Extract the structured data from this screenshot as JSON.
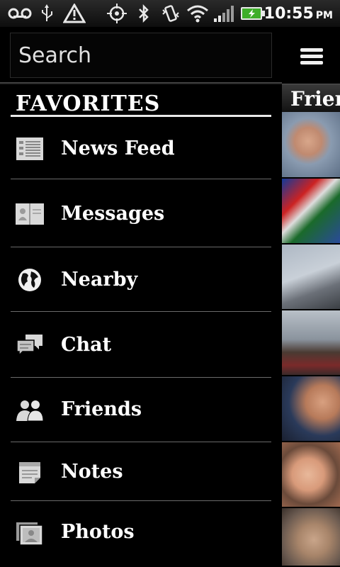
{
  "status_bar": {
    "time": "10:55",
    "ampm": "PM",
    "icons": [
      "voicemail-icon",
      "usb-icon",
      "warning-icon",
      "gps-icon",
      "bluetooth-icon",
      "vibrate-icon",
      "wifi-icon",
      "signal-icon",
      "battery-icon"
    ]
  },
  "search": {
    "placeholder": "Search"
  },
  "favorites": {
    "title": "FAVORITES",
    "items": [
      {
        "label": "News Feed",
        "icon": "news-feed-icon"
      },
      {
        "label": "Messages",
        "icon": "messages-icon"
      },
      {
        "label": "Nearby",
        "icon": "globe-icon"
      },
      {
        "label": "Chat",
        "icon": "chat-icon"
      },
      {
        "label": "Friends",
        "icon": "friends-icon"
      },
      {
        "label": "Notes",
        "icon": "notes-icon"
      },
      {
        "label": "Photos",
        "icon": "photos-icon"
      }
    ]
  },
  "feed": {
    "title": "Friends",
    "menu_icon": "hamburger-menu-icon"
  },
  "colors": {
    "background": "#000000",
    "text": "#ffffff",
    "divider": "#6a6a6a"
  }
}
